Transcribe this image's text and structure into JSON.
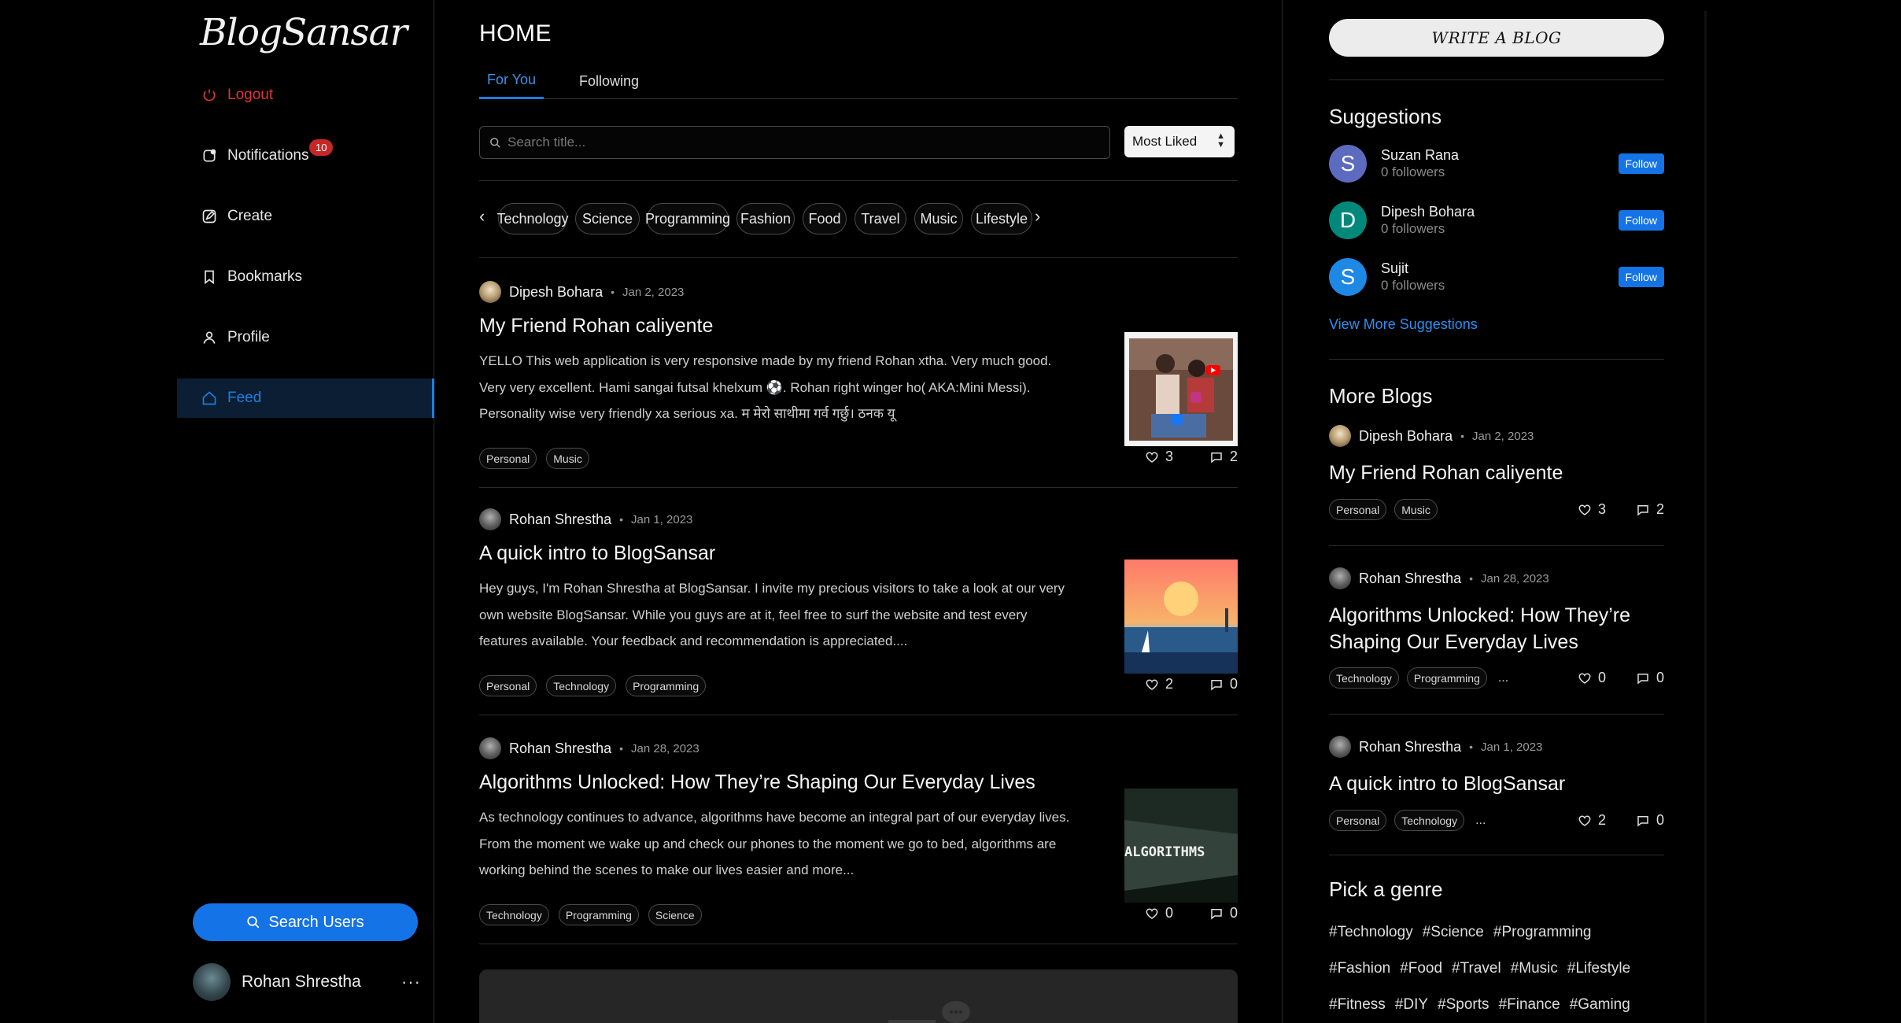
{
  "app": {
    "logo": "BlogSansar"
  },
  "sidebar": {
    "logout": "Logout",
    "notifications": "Notifications",
    "notification_count": "10",
    "create": "Create",
    "bookmarks": "Bookmarks",
    "profile": "Profile",
    "feed": "Feed",
    "search_users": "Search Users",
    "current_user": {
      "name": "Rohan Shrestha",
      "menu": "···"
    }
  },
  "main": {
    "title": "HOME",
    "tabs": [
      "For You",
      "Following"
    ],
    "search": {
      "placeholder": "Search title...",
      "value": ""
    },
    "sort": {
      "selected": "Most Liked"
    },
    "categories": [
      "Technology",
      "Science",
      "Programming",
      "Fashion",
      "Food",
      "Travel",
      "Music",
      "Lifestyle"
    ],
    "posts": [
      {
        "author": "Dipesh Bohara",
        "date": "Jan 2, 2023",
        "title": "My Friend Rohan caliyente",
        "excerpt": "YELLO This web application is very responsive made by my friend Rohan xtha. Very much good. Very very excellent. Hami sangai futsal khelxum ⚽. Rohan right winger ho( AKA:Mini Messi). Personality wise very friendly xa serious xa. म मेरो साथीमा गर्व गर्छु। ठनक यू",
        "tags": [
          "Personal",
          "Music"
        ],
        "likes": "3",
        "comments": "2"
      },
      {
        "author": "Rohan Shrestha",
        "date": "Jan 1, 2023",
        "title": "A quick intro to BlogSansar",
        "excerpt": "Hey guys, I'm Rohan Shrestha at BlogSansar. I invite my precious visitors to take a look at our very own website BlogSansar.   While you guys are at it, feel free to surf the website and test every features available. Your feedback and recommendation is appreciated....",
        "tags": [
          "Personal",
          "Technology",
          "Programming"
        ],
        "likes": "2",
        "comments": "0"
      },
      {
        "author": "Rohan Shrestha",
        "date": "Jan 28, 2023",
        "title": "Algorithms Unlocked: How They’re Shaping Our Everyday Lives",
        "excerpt": "As technology continues to advance, algorithms have become an integral part of our everyday lives. From the moment we wake up and check our phones to the moment we go to bed, algorithms are working behind the scenes to make our lives easier and more...",
        "tags": [
          "Technology",
          "Programming",
          "Science"
        ],
        "likes": "0",
        "comments": "0",
        "thumb_text": "ALGORITHMS"
      }
    ]
  },
  "right": {
    "write_button": "WRITE A BLOG",
    "suggestions_title": "Suggestions",
    "suggestions": [
      {
        "initial": "S",
        "name": "Suzan Rana",
        "followers": "0 followers",
        "color": "#5c6bc0",
        "action": "Follow"
      },
      {
        "initial": "D",
        "name": "Dipesh Bohara",
        "followers": "0 followers",
        "color": "#00897b",
        "action": "Follow"
      },
      {
        "initial": "S",
        "name": "Sujit",
        "followers": "0 followers",
        "color": "#1e88e5",
        "action": "Follow"
      }
    ],
    "view_more": "View More Suggestions",
    "more_blogs_title": "More Blogs",
    "more_blogs": [
      {
        "author": "Dipesh Bohara",
        "date": "Jan 2, 2023",
        "title": "My Friend Rohan caliyente",
        "tags": [
          "Personal",
          "Music"
        ],
        "more": "",
        "likes": "3",
        "comments": "2"
      },
      {
        "author": "Rohan Shrestha",
        "date": "Jan 28, 2023",
        "title": "Algorithms Unlocked: How They’re Shaping Our Everyday Lives",
        "tags": [
          "Technology",
          "Programming"
        ],
        "more": "...",
        "likes": "0",
        "comments": "0"
      },
      {
        "author": "Rohan Shrestha",
        "date": "Jan 1, 2023",
        "title": "A quick intro to BlogSansar",
        "tags": [
          "Personal",
          "Technology"
        ],
        "more": "...",
        "likes": "2",
        "comments": "0"
      }
    ],
    "genre_title": "Pick a genre",
    "genres": [
      [
        "#Technology",
        "#Science",
        "#Programming"
      ],
      [
        "#Fashion",
        "#Food",
        "#Travel",
        "#Music",
        "#Lifestyle"
      ],
      [
        "#Fitness",
        "#DIY",
        "#Sports",
        "#Finance",
        "#Gaming"
      ]
    ]
  },
  "colors": {
    "accent": "#1c7fe0",
    "logout": "#e0353a",
    "badge": "#c62828",
    "button": "#1473e6"
  }
}
